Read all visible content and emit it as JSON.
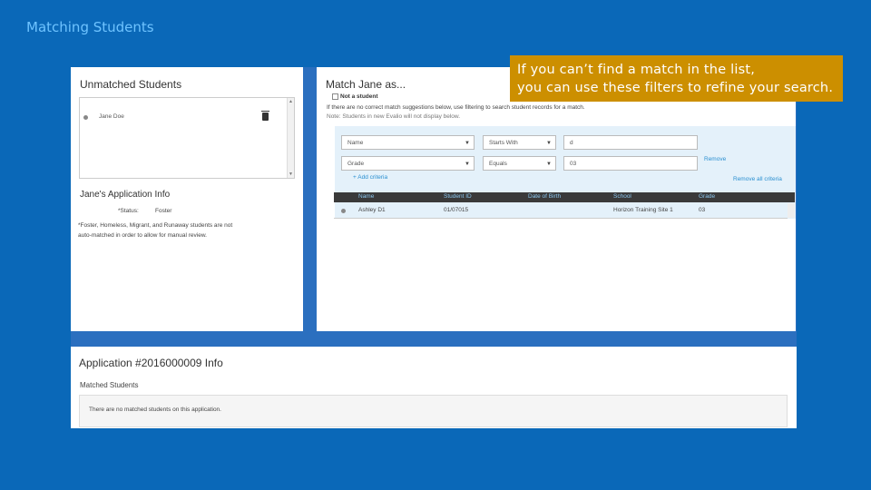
{
  "slide": {
    "title": "Matching Students"
  },
  "callout": {
    "line1": "If you can’t find a match in the list,",
    "line2": "you can use these filters to refine your search."
  },
  "unmatched": {
    "heading": "Unmatched Students",
    "student_name": "Jane Doe",
    "app_info_heading": "Jane's Application Info",
    "status_label": "*Status:",
    "status_value": "Foster",
    "footnote_line1": "*Foster, Homeless, Migrant, and Runaway students are not",
    "footnote_line2": "auto-matched in order to allow for manual review."
  },
  "match": {
    "heading": "Match Jane as...",
    "not_a_student": "Not a student",
    "info_line1": "If there are no correct match suggestions below, use filtering to search student records for a match.",
    "info_line2": "Note: Students in new Evalio will not display below.",
    "filters": [
      {
        "field": "Name",
        "operator": "Starts With",
        "value": "d"
      },
      {
        "field": "Grade",
        "operator": "Equals",
        "value": "03"
      }
    ],
    "remove": "Remove",
    "add_criteria": "+ Add criteria",
    "remove_all_criteria": "Remove all criteria"
  },
  "results": {
    "columns": [
      "Name",
      "Student ID",
      "Date of Birth",
      "School",
      "Grade"
    ],
    "rows": [
      {
        "name": "Ashley D1",
        "student_id": "01/07015",
        "dob": "",
        "school": "Horizon Training Site 1",
        "grade": "03"
      }
    ]
  },
  "application": {
    "heading": "Application #2016000009 Info",
    "matched_heading": "Matched Students",
    "empty_message": "There are no matched students on this application."
  }
}
